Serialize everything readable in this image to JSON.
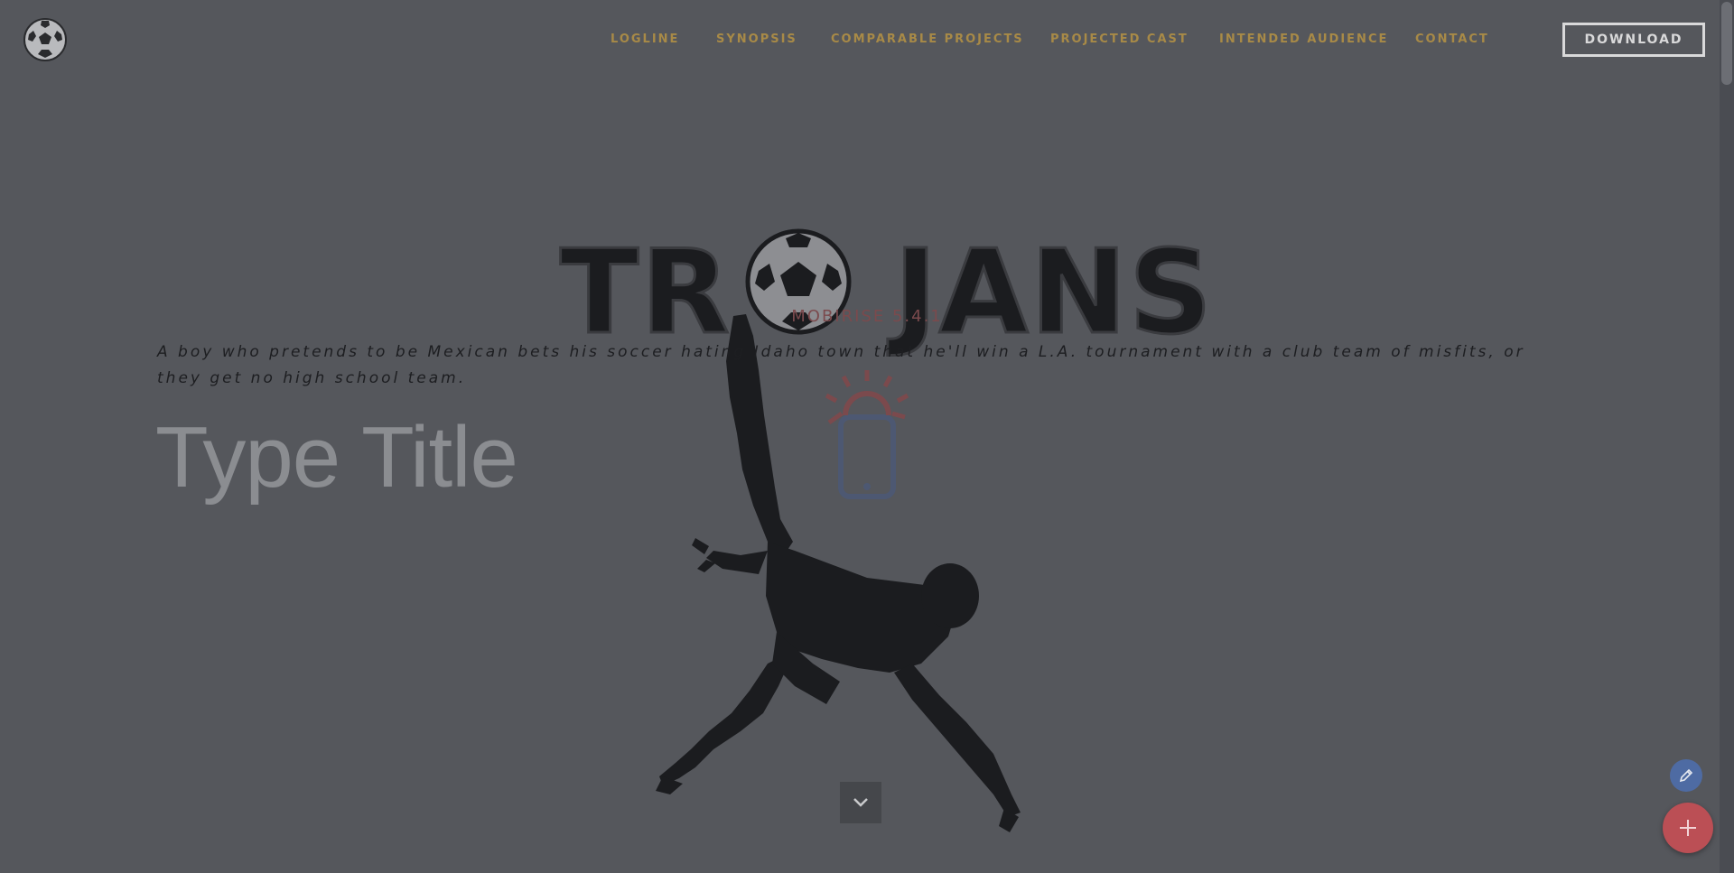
{
  "header": {
    "logo_icon": "soccer-ball-icon",
    "nav_items": [
      {
        "label": "LOGLINE"
      },
      {
        "label": "SYNOPSIS"
      },
      {
        "label": "COMPARABLE PROJECTS"
      },
      {
        "label": "PROJECTED CAST"
      },
      {
        "label": "INTENDED AUDIENCE"
      },
      {
        "label": "CONTACT"
      }
    ],
    "download_label": "DOWNLOAD"
  },
  "hero": {
    "logo_wordmark": "TROJANS",
    "builder_label": "MOBIRISE 5.4.1",
    "logline": "A boy who pretends to be Mexican bets his soccer hating Idaho town that he'll win a L.A. tournament with a club team of misfits, or they get no high school team.",
    "title_placeholder": "Type Title",
    "scroll_icon": "chevron-down-icon"
  },
  "floating_buttons": {
    "edit_icon": "pencil-icon",
    "add_icon": "plus-icon"
  },
  "colors": {
    "background": "#55575c",
    "nav_link": "#a88a47",
    "add_button": "#bb4f55",
    "edit_button": "#4e6ba3",
    "silhouette": "#1b1c1f"
  }
}
